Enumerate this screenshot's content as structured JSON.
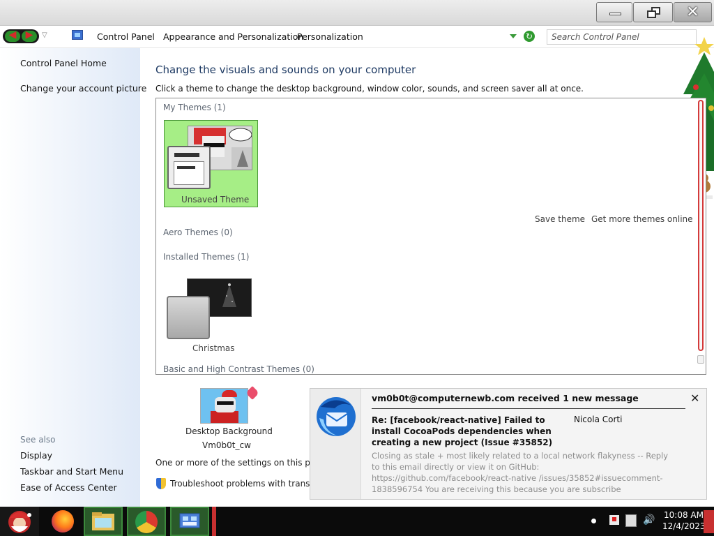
{
  "address_bar": {
    "breadcrumbs": [
      "Control Panel",
      "Appearance and Personalization",
      "Personalization"
    ],
    "search_placeholder": "Search Control Panel"
  },
  "sidebar": {
    "items": [
      "Control Panel Home",
      "Change your account picture"
    ],
    "see_also_label": "See also",
    "see_also_items": [
      "Display",
      "Taskbar and Start Menu",
      "Ease of Access Center"
    ]
  },
  "main": {
    "title": "Change the visuals and sounds on your computer",
    "description": "Click a theme to change the desktop background, window color, sounds, and screen saver all at once.",
    "groups": {
      "my_themes": "My Themes (1)",
      "aero_themes": "Aero Themes (0)",
      "installed_themes": "Installed Themes (1)",
      "basic_themes": "Basic and High Contrast Themes (0)"
    },
    "themes": {
      "unsaved": "Unsaved Theme",
      "christmas": "Christmas"
    },
    "links": {
      "save_theme": "Save theme",
      "get_more": "Get more themes online"
    },
    "desktop_background": {
      "label": "Desktop Background",
      "value": "Vm0b0t_cw"
    },
    "partial_text": "One or more of the settings on this page h",
    "troubleshoot": "Troubleshoot problems with transpare"
  },
  "toast": {
    "heading": "vm0b0t@computernewb.com received 1 new message",
    "subject": "Re: [facebook/react-native] Failed to install CocoaPods dependencies when creating a new project (Issue #35852)",
    "sender": "Nicola Corti",
    "body": "Closing as stale + most likely related to a local network flakyness -- Reply to this email directly or view it on GitHub: https://github.com/facebook/react-native /issues/35852#issuecomment-1838596754 You are receiving this because you are subscribe",
    "close_symbol": "✕"
  },
  "taskbar": {
    "time": "10:08 AM",
    "date": "12/4/2023",
    "apps": [
      "santa-start",
      "firefox",
      "file-explorer",
      "chrome",
      "control-panel"
    ]
  },
  "window_controls": {
    "minimize_icon": "minimize-icon",
    "maximize_icon": "restore-icon",
    "close_icon": "close-icon"
  }
}
